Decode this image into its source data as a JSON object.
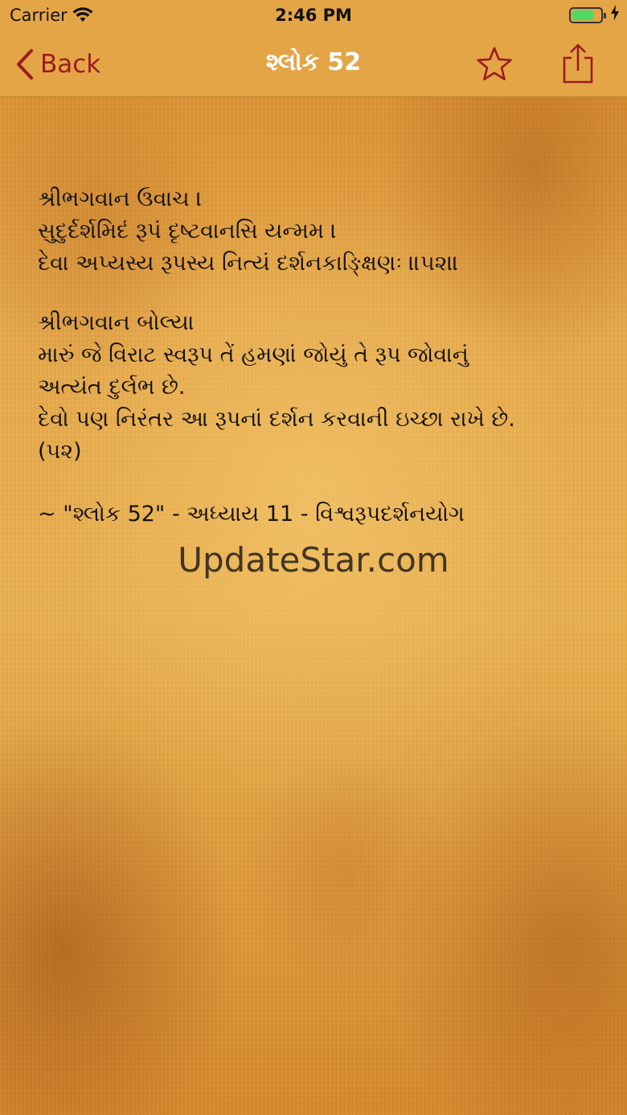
{
  "status_bar": {
    "carrier": "Carrier",
    "time": "2:46 PM",
    "battery_color": "#4cd964"
  },
  "nav": {
    "back_label": "Back",
    "title": "શ્લોક 52",
    "accent_color": "#9b1c1c",
    "star_icon": "star-outline",
    "share_icon": "share"
  },
  "content": {
    "verse_lines": [
      "શ્રીભગવાન ઉવાચ ।",
      "સુદુર્દર્શમિદં રૂપં દૃષ્ટવાનસિ યન્મમ  ।",
      "દેવા અપ્યસ્ય રૂપસ્ય નિત્યં દર્શનકાઙ્ક્ષિણઃ   ॥૫૨॥"
    ],
    "translation_lines": [
      "શ્રીભગવાન બોલ્યા",
      "મારું જે  વિરાટ સ્વરૂપ તેં હમણાં જોયું તે રૂપ જોવાનું",
      "અત્યંત દુર્લભ છે.",
      "દેવો પણ નિરંતર આ રૂપનાં દર્શન કરવાની ઇચ્છા રાખે છે.",
      "(૫૨)"
    ],
    "reference": "~ \"શ્લોક 52\" - અધ્યાય 11 - વિશ્વરૂપદર્શનયોગ"
  },
  "watermark": "UpdateStar.com"
}
